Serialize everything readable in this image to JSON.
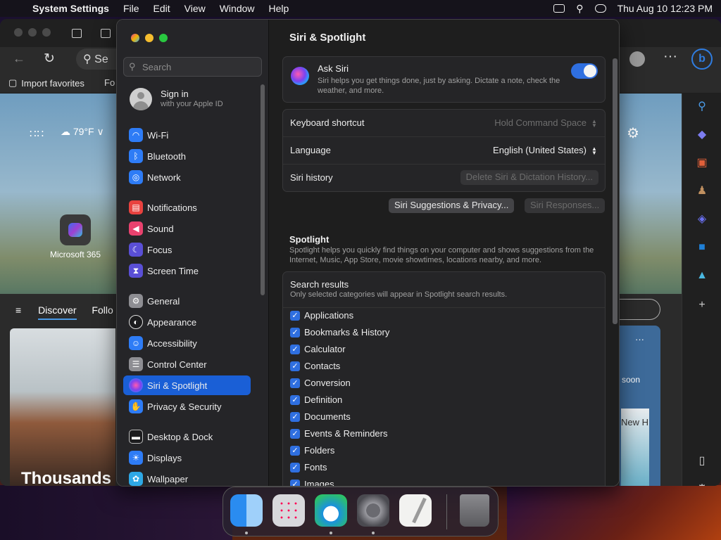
{
  "menubar": {
    "app_name": "System Settings",
    "items": [
      "File",
      "Edit",
      "View",
      "Window",
      "Help"
    ],
    "clock": "Thu Aug 10  12:23 PM"
  },
  "browser": {
    "search_placeholder": "Se",
    "favorites": [
      "Import favorites",
      "Fo"
    ],
    "weather": "79°F",
    "tile_label": "Microsoft 365",
    "feed_tabs": [
      "Discover",
      "Follo"
    ],
    "headline": "Thousands",
    "right_text": "soon",
    "map_text": "New H"
  },
  "sidebar": {
    "search_placeholder": "Search",
    "signin": {
      "title": "Sign in",
      "subtitle": "with your Apple ID"
    },
    "items": [
      {
        "label": "Wi-Fi",
        "icon": "wifi-icon",
        "color": "#2e7cf6"
      },
      {
        "label": "Bluetooth",
        "icon": "bluetooth-icon",
        "color": "#2e7cf6"
      },
      {
        "label": "Network",
        "icon": "globe-icon",
        "color": "#2e7cf6"
      },
      {
        "label": "Notifications",
        "icon": "bell-icon",
        "color": "#e9423f"
      },
      {
        "label": "Sound",
        "icon": "speaker-icon",
        "color": "#e9426e"
      },
      {
        "label": "Focus",
        "icon": "moon-icon",
        "color": "#5a4fd6"
      },
      {
        "label": "Screen Time",
        "icon": "hourglass-icon",
        "color": "#5a4fd6"
      },
      {
        "label": "General",
        "icon": "gear-icon",
        "color": "#8e8e93"
      },
      {
        "label": "Appearance",
        "icon": "appearance-icon",
        "color": "#1c1c1e"
      },
      {
        "label": "Accessibility",
        "icon": "accessibility-icon",
        "color": "#2e7cf6"
      },
      {
        "label": "Control Center",
        "icon": "control-center-icon",
        "color": "#8e8e93"
      },
      {
        "label": "Siri & Spotlight",
        "icon": "siri-icon",
        "color": "#7b42f0"
      },
      {
        "label": "Privacy & Security",
        "icon": "hand-icon",
        "color": "#2e7cf6"
      },
      {
        "label": "Desktop & Dock",
        "icon": "dock-icon",
        "color": "#1c1c1e"
      },
      {
        "label": "Displays",
        "icon": "sun-icon",
        "color": "#2e7cf6"
      },
      {
        "label": "Wallpaper",
        "icon": "wallpaper-icon",
        "color": "#2ea8e6"
      }
    ]
  },
  "content": {
    "title": "Siri & Spotlight",
    "ask_siri": {
      "title": "Ask Siri",
      "description": "Siri helps you get things done, just by asking. Dictate a note, check the weather, and more.",
      "enabled": true
    },
    "settings": {
      "keyboard_shortcut": {
        "label": "Keyboard shortcut",
        "value": "Hold Command Space"
      },
      "language": {
        "label": "Language",
        "value": "English (United States)"
      },
      "history": {
        "label": "Siri history",
        "button": "Delete Siri & Dictation History..."
      }
    },
    "buttons": {
      "suggestions": "Siri Suggestions & Privacy...",
      "responses": "Siri Responses..."
    },
    "spotlight": {
      "title": "Spotlight",
      "description": "Spotlight helps you quickly find things on your computer and shows suggestions from the Internet, Music, App Store, movie showtimes, locations nearby, and more."
    },
    "search_results": {
      "title": "Search results",
      "description": "Only selected categories will appear in Spotlight search results.",
      "categories": [
        {
          "label": "Applications",
          "checked": true
        },
        {
          "label": "Bookmarks & History",
          "checked": true
        },
        {
          "label": "Calculator",
          "checked": true
        },
        {
          "label": "Contacts",
          "checked": true
        },
        {
          "label": "Conversion",
          "checked": true
        },
        {
          "label": "Definition",
          "checked": true
        },
        {
          "label": "Documents",
          "checked": true
        },
        {
          "label": "Events & Reminders",
          "checked": true
        },
        {
          "label": "Folders",
          "checked": true
        },
        {
          "label": "Fonts",
          "checked": true
        },
        {
          "label": "Images",
          "checked": true
        }
      ]
    }
  },
  "dock": {
    "apps": [
      "Finder",
      "Launchpad",
      "Microsoft Edge",
      "System Settings",
      "TextEdit",
      "Trash"
    ]
  }
}
